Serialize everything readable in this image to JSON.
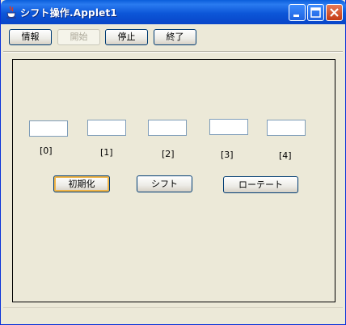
{
  "window": {
    "title": "シフト操作.Applet1"
  },
  "toolbar": {
    "info_label": "情報",
    "start_label": "開始",
    "stop_label": "停止",
    "exit_label": "終了"
  },
  "panel": {
    "fields": [
      {
        "value": "",
        "index_label": "[0]"
      },
      {
        "value": "",
        "index_label": "[1]"
      },
      {
        "value": "",
        "index_label": "[2]"
      },
      {
        "value": "",
        "index_label": "[3]"
      },
      {
        "value": "",
        "index_label": "[4]"
      }
    ],
    "init_label": "初期化",
    "shift_label": "シフト",
    "rotate_label": "ローテート"
  },
  "colors": {
    "titlebar": "#0c56d8",
    "face": "#ece9d8",
    "close_button": "#c43b15"
  },
  "icons": [
    "java-coffee-icon",
    "minimize-icon",
    "maximize-icon",
    "close-icon"
  ]
}
